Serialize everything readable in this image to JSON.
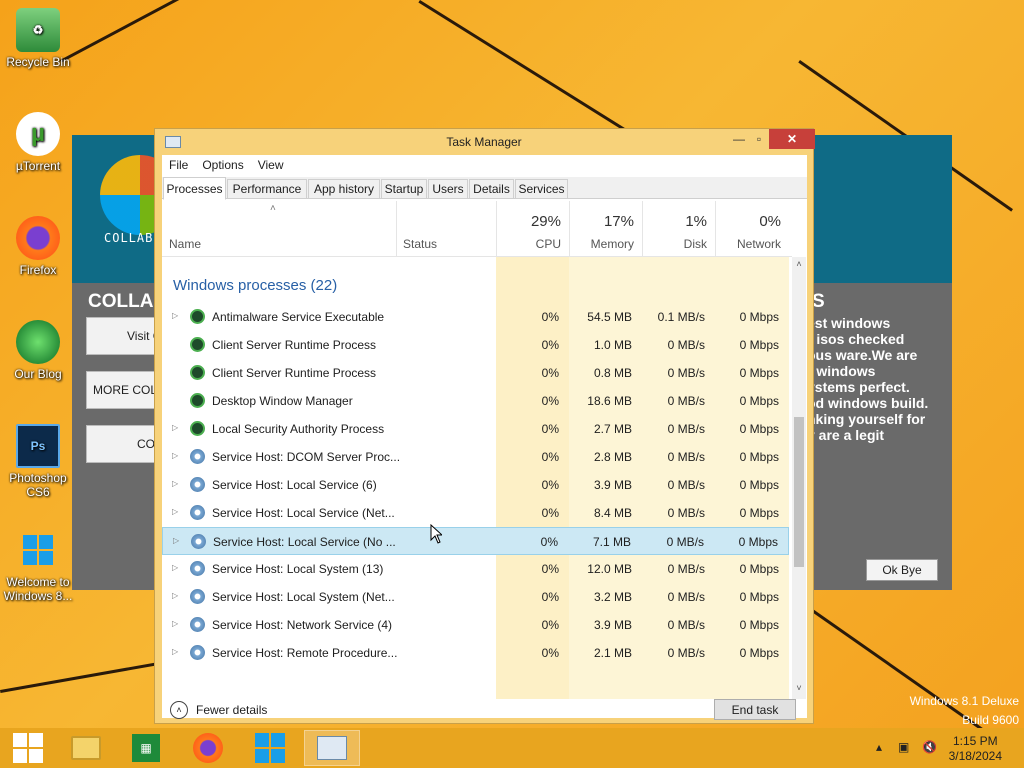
{
  "desktop": {
    "icons": [
      {
        "label": "Recycle Bin"
      },
      {
        "label": "µTorrent"
      },
      {
        "label": "Firefox"
      },
      {
        "label": "Our Blog"
      },
      {
        "label": "Photoshop CS6"
      },
      {
        "label": "Welcome to Windows 8..."
      }
    ],
    "watermark": {
      "line1": "Windows 8.1 Deluxe",
      "line2": "Build 9600"
    }
  },
  "background_app": {
    "logo_text": "COLLABS QUALITY W",
    "headline": "COLLA",
    "headline_right": "S",
    "buttons": [
      "Visit C",
      "MORE COLL",
      "CO"
    ],
    "right_text": "est windows\nr isos checked\nous ware.We are\nr windows\nystems perfect.\nod windows build.\nnking yourself for\ny are a legit",
    "ok_button": "Ok Bye"
  },
  "task_manager": {
    "title": "Task Manager",
    "menu": [
      "File",
      "Options",
      "View"
    ],
    "tabs": [
      "Processes",
      "Performance",
      "App history",
      "Startup",
      "Users",
      "Details",
      "Services"
    ],
    "active_tab": "Processes",
    "columns": {
      "name": "Name",
      "status": "Status",
      "cpu": {
        "pct": "29%",
        "label": "CPU"
      },
      "memory": {
        "pct": "17%",
        "label": "Memory"
      },
      "disk": {
        "pct": "1%",
        "label": "Disk"
      },
      "network": {
        "pct": "0%",
        "label": "Network"
      }
    },
    "group_label": "Windows processes (22)",
    "processes": [
      {
        "name": "Antimalware Service Executable",
        "icon": "process-icon",
        "expandable": true,
        "cpu": "0%",
        "memory": "54.5 MB",
        "disk": "0.1 MB/s",
        "network": "0 Mbps"
      },
      {
        "name": "Client Server Runtime Process",
        "icon": "process-icon",
        "expandable": false,
        "cpu": "0%",
        "memory": "1.0 MB",
        "disk": "0 MB/s",
        "network": "0 Mbps"
      },
      {
        "name": "Client Server Runtime Process",
        "icon": "process-icon",
        "expandable": false,
        "cpu": "0%",
        "memory": "0.8 MB",
        "disk": "0 MB/s",
        "network": "0 Mbps"
      },
      {
        "name": "Desktop Window Manager",
        "icon": "process-icon",
        "expandable": false,
        "cpu": "0%",
        "memory": "18.6 MB",
        "disk": "0 MB/s",
        "network": "0 Mbps"
      },
      {
        "name": "Local Security Authority Process",
        "icon": "process-icon",
        "expandable": true,
        "cpu": "0%",
        "memory": "2.7 MB",
        "disk": "0 MB/s",
        "network": "0 Mbps"
      },
      {
        "name": "Service Host: DCOM Server Proc...",
        "icon": "gear-icon",
        "expandable": true,
        "cpu": "0%",
        "memory": "2.8 MB",
        "disk": "0 MB/s",
        "network": "0 Mbps"
      },
      {
        "name": "Service Host: Local Service (6)",
        "icon": "gear-icon",
        "expandable": true,
        "cpu": "0%",
        "memory": "3.9 MB",
        "disk": "0 MB/s",
        "network": "0 Mbps"
      },
      {
        "name": "Service Host: Local Service (Net...",
        "icon": "gear-icon",
        "expandable": true,
        "cpu": "0%",
        "memory": "8.4 MB",
        "disk": "0 MB/s",
        "network": "0 Mbps"
      },
      {
        "name": "Service Host: Local Service (No ...",
        "icon": "gear-icon",
        "expandable": true,
        "selected": true,
        "cpu": "0%",
        "memory": "7.1 MB",
        "disk": "0 MB/s",
        "network": "0 Mbps"
      },
      {
        "name": "Service Host: Local System (13)",
        "icon": "gear-icon",
        "expandable": true,
        "cpu": "0%",
        "memory": "12.0 MB",
        "disk": "0 MB/s",
        "network": "0 Mbps"
      },
      {
        "name": "Service Host: Local System (Net...",
        "icon": "gear-icon",
        "expandable": true,
        "cpu": "0%",
        "memory": "3.2 MB",
        "disk": "0 MB/s",
        "network": "0 Mbps"
      },
      {
        "name": "Service Host: Network Service (4)",
        "icon": "gear-icon",
        "expandable": true,
        "cpu": "0%",
        "memory": "3.9 MB",
        "disk": "0 MB/s",
        "network": "0 Mbps"
      },
      {
        "name": "Service Host: Remote Procedure...",
        "icon": "gear-icon",
        "expandable": true,
        "cpu": "0%",
        "memory": "2.1 MB",
        "disk": "0 MB/s",
        "network": "0 Mbps"
      }
    ],
    "footer": {
      "fewer_details": "Fewer details",
      "end_task": "End task"
    }
  },
  "taskbar": {
    "items": [
      "start-icon",
      "file-explorer-icon",
      "store-icon",
      "firefox-icon",
      "windows-app-icon",
      "task-manager-icon"
    ],
    "clock": {
      "time": "1:15 PM",
      "date": "3/18/2024"
    }
  },
  "colors": {
    "accent": "#2860a6",
    "window_frame": "#f7d27a",
    "selection": "#cce8f4",
    "close": "#c7403a"
  }
}
